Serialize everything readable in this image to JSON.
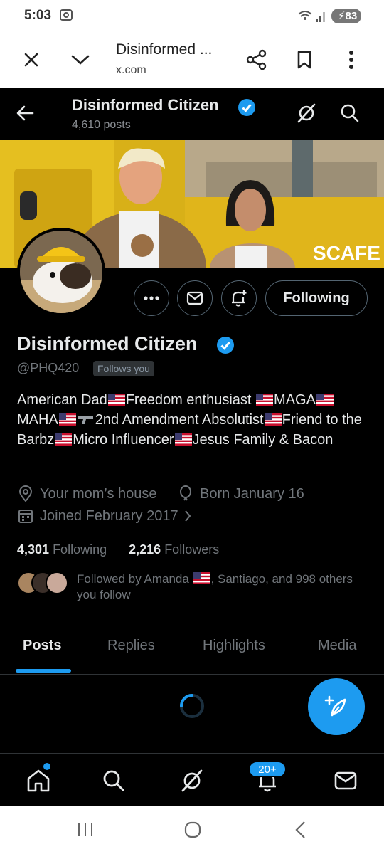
{
  "status_bar": {
    "time": "5:03",
    "battery": "83"
  },
  "browser": {
    "title": "Disinformed ...",
    "host": "x.com"
  },
  "profile_header": {
    "name": "Disinformed Citizen",
    "posts_count": "4,610 posts"
  },
  "profile": {
    "following_button": "Following",
    "display_name": "Disinformed Citizen",
    "handle": "@PHQ420",
    "follows_you": "Follows you",
    "bio": {
      "p1": "American Dad",
      "p2": "Freedom enthusiast ",
      "p3": "MAGA",
      "p4": "MAHA",
      "p5": "2nd Amendment Absolutist",
      "p6": "Friend to the Barbz",
      "p7": "Micro Influencer",
      "p8": "Jesus Family & Bacon"
    },
    "location": "Your mom’s house",
    "birthday": "Born January 16",
    "joined": "Joined February 2017",
    "following_count": "4,301",
    "following_label": "Following",
    "followers_count": "2,216",
    "followers_label": "Followers",
    "followed_by_a": "Followed by Amanda ",
    "followed_by_b": ", Santiago, and 998 others you follow"
  },
  "tabs": [
    "Posts",
    "Replies",
    "Highlights",
    "Media"
  ],
  "bottom_nav": {
    "notifications_badge": "20+"
  },
  "colors": {
    "accent": "#1d9bf0",
    "background": "#000000",
    "text_primary": "#e7e9ea",
    "text_secondary": "#71767b"
  }
}
